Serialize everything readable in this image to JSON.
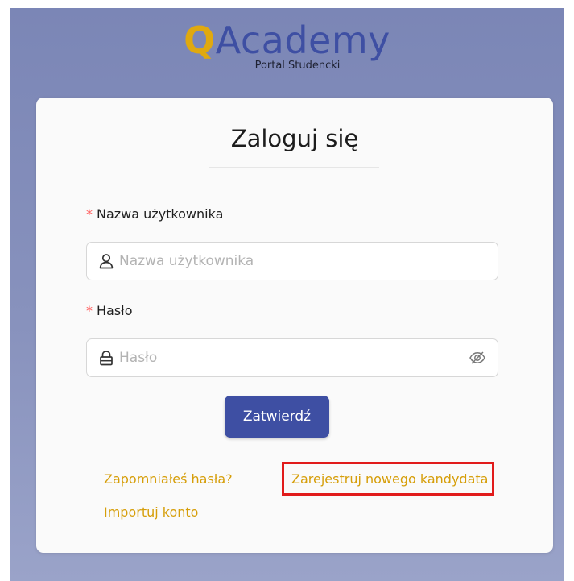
{
  "logo": {
    "brand_first": "Q",
    "brand_rest": "Academy",
    "subtitle": "Portal Studencki",
    "colors": {
      "q": "#e0a90f",
      "rest": "#3e4fa3"
    }
  },
  "form": {
    "title": "Zaloguj się",
    "username": {
      "required_mark": "*",
      "label": "Nazwa użytkownika",
      "placeholder": "Nazwa użytkownika",
      "value": "",
      "icon": "user-icon"
    },
    "password": {
      "required_mark": "*",
      "label": "Hasło",
      "placeholder": "Hasło",
      "value": "",
      "icon": "lock-icon",
      "toggle_icon": "eye-slash-icon"
    },
    "submit_label": "Zatwierdź"
  },
  "links": {
    "forgot_password": "Zapomniałeś hasła?",
    "register_candidate": "Zarejestruj nowego kandydata",
    "import_account": "Importuj konto"
  },
  "colors": {
    "background": "#7b86b6",
    "primary": "#3e4fa3",
    "link": "#d69e09",
    "required": "#ff5a5a",
    "highlight": "#e11b1b"
  }
}
